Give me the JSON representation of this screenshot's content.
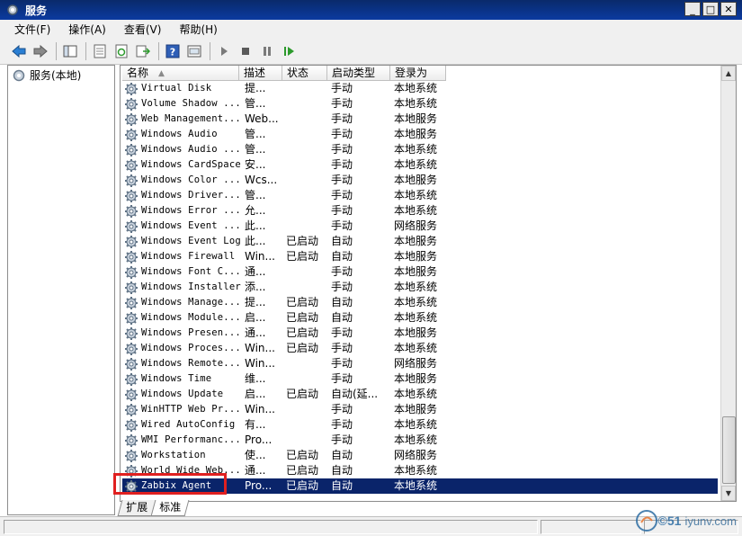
{
  "window": {
    "title": "服务"
  },
  "menu": [
    "文件(F)",
    "操作(A)",
    "查看(V)",
    "帮助(H)"
  ],
  "toolbar": [
    "back-icon",
    "forward-icon",
    "show-hide-tree-icon",
    "properties-icon",
    "refresh-icon",
    "export-list-icon",
    "help-icon",
    "console-icon",
    "start-icon",
    "stop-icon",
    "pause-icon",
    "restart-icon"
  ],
  "tree": {
    "root": "服务(本地)"
  },
  "columns": {
    "name": "名称",
    "desc": "描述",
    "state": "状态",
    "start": "启动类型",
    "logon": "登录为"
  },
  "rows": [
    {
      "name": "Virtual Disk",
      "desc": "提...",
      "state": "",
      "start": "手动",
      "logon": "本地系统"
    },
    {
      "name": "Volume Shadow ...",
      "desc": "管...",
      "state": "",
      "start": "手动",
      "logon": "本地系统"
    },
    {
      "name": "Web Management...",
      "desc": "Web...",
      "state": "",
      "start": "手动",
      "logon": "本地服务"
    },
    {
      "name": "Windows Audio",
      "desc": "管...",
      "state": "",
      "start": "手动",
      "logon": "本地服务"
    },
    {
      "name": "Windows Audio ...",
      "desc": "管...",
      "state": "",
      "start": "手动",
      "logon": "本地系统"
    },
    {
      "name": "Windows CardSpace",
      "desc": "安...",
      "state": "",
      "start": "手动",
      "logon": "本地系统"
    },
    {
      "name": "Windows Color ...",
      "desc": "Wcs...",
      "state": "",
      "start": "手动",
      "logon": "本地服务"
    },
    {
      "name": "Windows Driver...",
      "desc": "管...",
      "state": "",
      "start": "手动",
      "logon": "本地系统"
    },
    {
      "name": "Windows Error ...",
      "desc": "允...",
      "state": "",
      "start": "手动",
      "logon": "本地系统"
    },
    {
      "name": "Windows Event ...",
      "desc": "此...",
      "state": "",
      "start": "手动",
      "logon": "网络服务"
    },
    {
      "name": "Windows Event Log",
      "desc": "此...",
      "state": "已启动",
      "start": "自动",
      "logon": "本地服务"
    },
    {
      "name": "Windows Firewall",
      "desc": "Win...",
      "state": "已启动",
      "start": "自动",
      "logon": "本地服务"
    },
    {
      "name": "Windows Font C...",
      "desc": "通...",
      "state": "",
      "start": "手动",
      "logon": "本地服务"
    },
    {
      "name": "Windows Installer",
      "desc": "添...",
      "state": "",
      "start": "手动",
      "logon": "本地系统"
    },
    {
      "name": "Windows Manage...",
      "desc": "提...",
      "state": "已启动",
      "start": "自动",
      "logon": "本地系统"
    },
    {
      "name": "Windows Module...",
      "desc": "启...",
      "state": "已启动",
      "start": "自动",
      "logon": "本地系统"
    },
    {
      "name": "Windows Presen...",
      "desc": "通...",
      "state": "已启动",
      "start": "手动",
      "logon": "本地服务"
    },
    {
      "name": "Windows Proces...",
      "desc": "Win...",
      "state": "已启动",
      "start": "手动",
      "logon": "本地系统"
    },
    {
      "name": "Windows Remote...",
      "desc": "Win...",
      "state": "",
      "start": "手动",
      "logon": "网络服务"
    },
    {
      "name": "Windows Time",
      "desc": "维...",
      "state": "",
      "start": "手动",
      "logon": "本地服务"
    },
    {
      "name": "Windows Update",
      "desc": "启...",
      "state": "已启动",
      "start": "自动(延...",
      "logon": "本地系统"
    },
    {
      "name": "WinHTTP Web Pr...",
      "desc": "Win...",
      "state": "",
      "start": "手动",
      "logon": "本地服务"
    },
    {
      "name": "Wired AutoConfig",
      "desc": "有...",
      "state": "",
      "start": "手动",
      "logon": "本地系统"
    },
    {
      "name": "WMI Performanc...",
      "desc": "Pro...",
      "state": "",
      "start": "手动",
      "logon": "本地系统"
    },
    {
      "name": "Workstation",
      "desc": "使...",
      "state": "已启动",
      "start": "自动",
      "logon": "网络服务"
    },
    {
      "name": "World Wide Web...",
      "desc": "通...",
      "state": "已启动",
      "start": "自动",
      "logon": "本地系统"
    },
    {
      "name": "Zabbix Agent",
      "desc": "Pro...",
      "state": "已启动",
      "start": "自动",
      "logon": "本地系统",
      "selected": true
    }
  ],
  "tabs": [
    "扩展",
    "标准"
  ],
  "watermark": {
    "brand": "运维网",
    "site": "iyunv.com",
    "prefix": "©51"
  },
  "colors": {
    "selection": "#0a246a",
    "highlight_box": "#e02020",
    "titlebar": "#0b3aa0"
  }
}
